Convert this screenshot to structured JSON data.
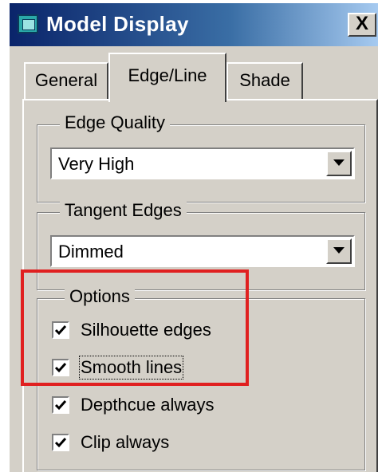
{
  "window": {
    "title": "Model Display",
    "close_glyph": "X",
    "icon": "model-display-icon"
  },
  "tabs": [
    {
      "label": "General",
      "selected": false
    },
    {
      "label": "Edge/Line",
      "selected": true
    },
    {
      "label": "Shade",
      "selected": false
    }
  ],
  "edge_quality": {
    "legend": "Edge Quality",
    "value": "Very High"
  },
  "tangent_edges": {
    "legend": "Tangent Edges",
    "value": "Dimmed"
  },
  "options": {
    "legend": "Options",
    "items": [
      {
        "label": "Silhouette edges",
        "checked": true
      },
      {
        "label": "Smooth lines",
        "checked": true
      },
      {
        "label": "Depthcue always",
        "checked": true
      },
      {
        "label": "Clip always",
        "checked": true
      }
    ]
  },
  "colors": {
    "dialog_face": "#d4d0c8",
    "title_bar": "#0a246a",
    "annotation": "#e02020"
  }
}
